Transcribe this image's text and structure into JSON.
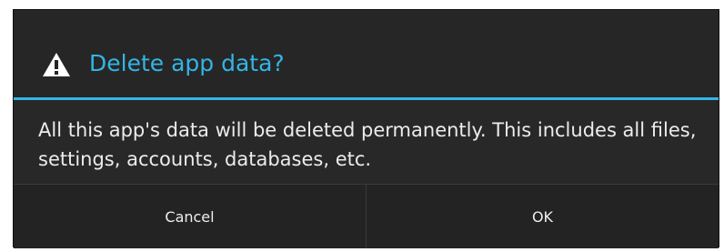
{
  "dialog": {
    "title": "Delete app data?",
    "message": "All this app's data will be deleted permanently. This includes all files, settings, accounts, databases, etc.",
    "icon": "alert-triangle-icon",
    "accent_color": "#33b5e5",
    "buttons": {
      "cancel_label": "Cancel",
      "ok_label": "OK"
    }
  }
}
